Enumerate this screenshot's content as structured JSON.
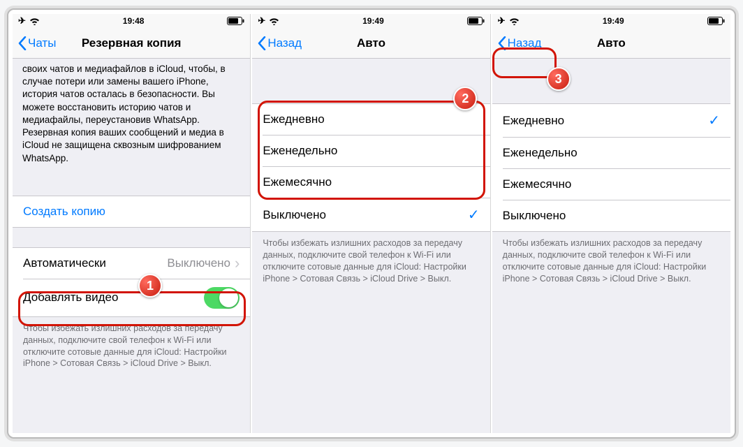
{
  "status": {
    "time1": "19:48",
    "time2": "19:49",
    "time3": "19:49"
  },
  "p1": {
    "back": "Чаты",
    "title": "Резервная копия",
    "desc": "своих чатов и медиафайлов в iCloud, чтобы, в случае потери или замены вашего iPhone, история чатов осталась в безопасности. Вы можете восстановить историю чатов и медиафайлы, переустановив WhatsApp. Резервная копия ваших сообщений и медиа в iCloud не защищена сквозным шифрованием WhatsApp.",
    "createBackup": "Создать копию",
    "autoLabel": "Автоматически",
    "autoValue": "Выключено",
    "videoLabel": "Добавлять видео",
    "footer": "Чтобы избежать излишних расходов за передачу данных, подключите свой телефон к Wi-Fi или отключите сотовые данные для iCloud: Настройки iPhone > Сотовая Связь > iCloud Drive > Выкл."
  },
  "p2": {
    "back": "Назад",
    "title": "Авто",
    "opts": [
      "Ежедневно",
      "Еженедельно",
      "Ежемесячно",
      "Выключено"
    ],
    "selected": 3,
    "footer": "Чтобы избежать излишних расходов за передачу данных, подключите свой телефон к Wi-Fi или отключите сотовые данные для iCloud: Настройки iPhone > Сотовая Связь > iCloud Drive > Выкл."
  },
  "p3": {
    "back": "Назад",
    "title": "Авто",
    "opts": [
      "Ежедневно",
      "Еженедельно",
      "Ежемесячно",
      "Выключено"
    ],
    "selected": 0,
    "footer": "Чтобы избежать излишних расходов за передачу данных, подключите свой телефон к Wi-Fi или отключите сотовые данные для iCloud: Настройки iPhone > Сотовая Связь > iCloud Drive > Выкл."
  },
  "badges": {
    "b1": "1",
    "b2": "2",
    "b3": "3"
  }
}
